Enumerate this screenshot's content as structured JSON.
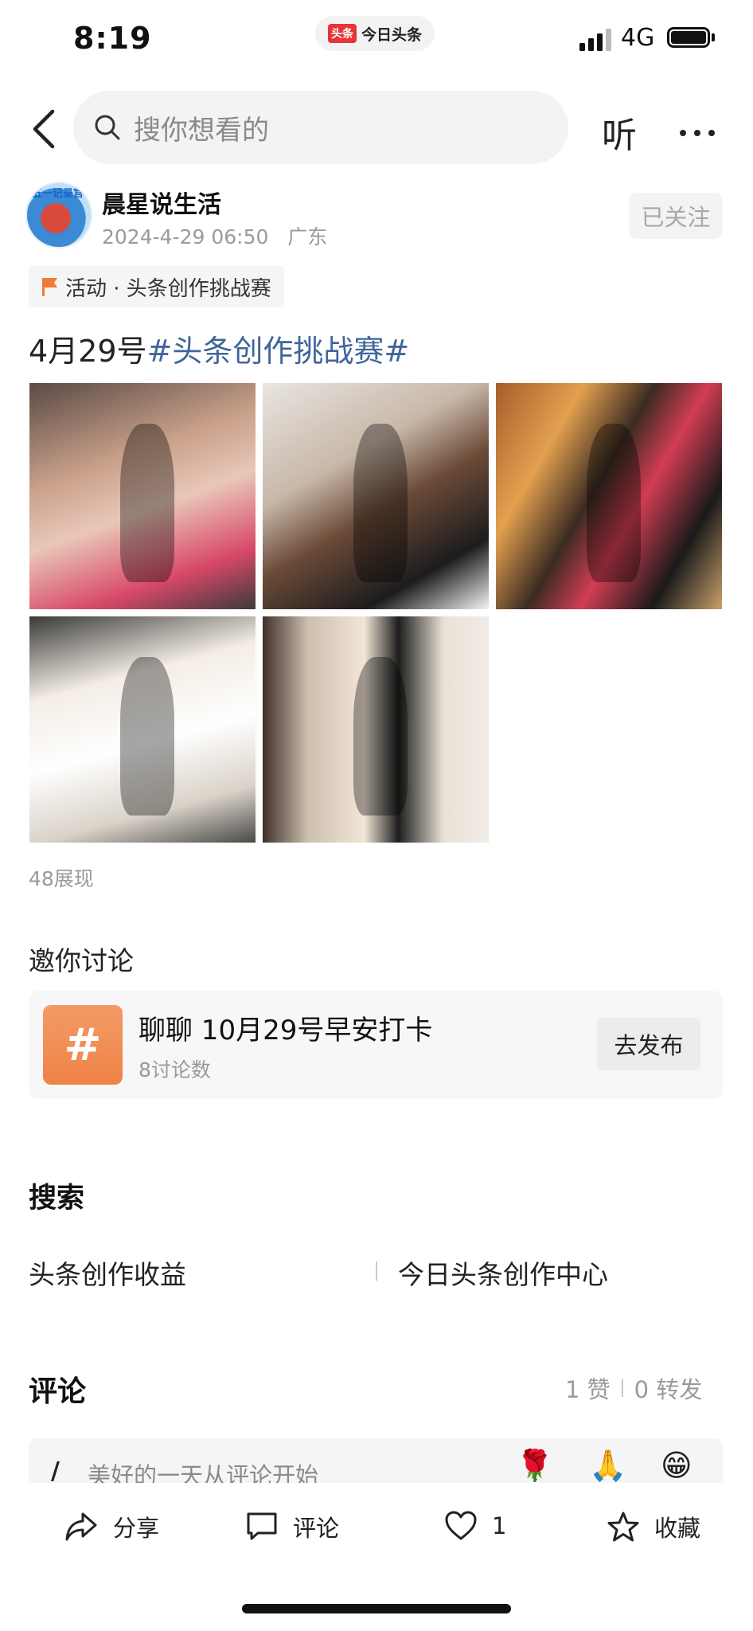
{
  "status_bar": {
    "time": "8:19",
    "app_logo": "头条",
    "app_name": "今日头条",
    "network": "4G"
  },
  "nav": {
    "search_placeholder": "搜你想看的",
    "listen_label": "听"
  },
  "author": {
    "name": "晨星说生活",
    "date": "2024-4-29 06:50",
    "location": "广东",
    "follow_label": "已关注",
    "avatar_badge": "五一记录官"
  },
  "activity": {
    "label": "活动 · 头条创作挑战赛",
    "flag_color": "#f07a3a"
  },
  "post": {
    "text_prefix": "4月29号",
    "hashtag": "#头条创作挑战赛#",
    "hashtag_color": "#406599",
    "images": 5,
    "views": "48展现"
  },
  "discussion": {
    "title": "邀你讨论",
    "topic": "聊聊 10月29号早安打卡",
    "count": "8讨论数",
    "publish_label": "去发布",
    "icon_symbol": "#"
  },
  "search_section": {
    "title": "搜索",
    "suggestions": [
      "头条创作收益",
      "今日头条创作中心"
    ]
  },
  "comments": {
    "title": "评论",
    "likes": "1 赞",
    "reposts": "0 转发",
    "input_placeholder": "美好的一天从评论开始",
    "quick_emojis": [
      "🌹",
      "🙏",
      "😁"
    ]
  },
  "bottom_bar": {
    "share_label": "分享",
    "comment_label": "评论",
    "like_count": "1",
    "collect_label": "收藏"
  }
}
